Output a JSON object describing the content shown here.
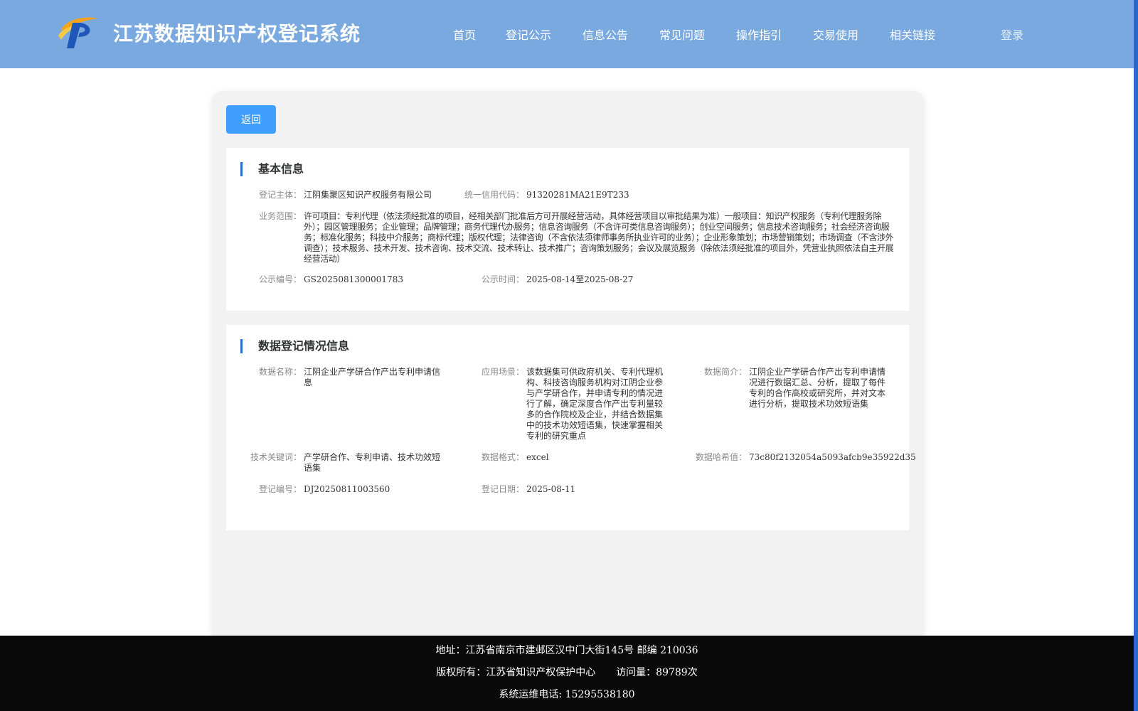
{
  "header": {
    "logo_icon": "ip-logo-icon",
    "title": "江苏数据知识产权登记系统",
    "nav": [
      "首页",
      "登记公示",
      "信息公告",
      "常见问题",
      "操作指引",
      "交易使用",
      "相关链接"
    ],
    "login": "登录"
  },
  "back_button": "返回",
  "basic_info": {
    "title": "基本信息",
    "registrant_label": "登记主体：",
    "registrant": "江阴集聚区知识产权服务有限公司",
    "credit_code_label": "统一信用代码：",
    "credit_code": "91320281MA21E9T233",
    "scope_label": "业务范围：",
    "scope": "许可项目：专利代理（依法须经批准的项目，经相关部门批准后方可开展经营活动，具体经营项目以审批结果为准）一般项目：知识产权服务（专利代理服务除外）；园区管理服务；企业管理；品牌管理；商务代理代办服务；信息咨询服务（不含许可类信息咨询服务）；创业空间服务；信息技术咨询服务；社会经济咨询服务；标准化服务；科技中介服务；商标代理；版权代理；法律咨询（不含依法须律师事务所执业许可的业务）；企业形象策划；市场营销策划；市场调查（不含涉外调查）；技术服务、技术开发、技术咨询、技术交流、技术转让、技术推广；咨询策划服务；会议及展览服务（除依法须经批准的项目外，凭营业执照依法自主开展经营活动）",
    "pub_no_label": "公示编号：",
    "pub_no": "GS2025081300001783",
    "pub_time_label": "公示时间：",
    "pub_time": "2025-08-14至2025-08-27"
  },
  "data_info": {
    "title": "数据登记情况信息",
    "name_label": "数据名称：",
    "name": "江阴企业产学研合作产出专利申请信息",
    "scenario_label": "应用场景：",
    "scenario": "该数据集可供政府机关、专利代理机构、科技咨询服务机构对江阴企业参与产学研合作，并申请专利的情况进行了解，确定深度合作产出专利量较多的合作院校及企业，并结合数据集中的技术功效短语集，快速掌握相关专利的研究重点",
    "summary_label": "数据简介：",
    "summary": "江阴企业产学研合作产出专利申请情况进行数据汇总、分析，提取了每件专利的合作高校或研究所，并对文本进行分析，提取技术功效短语集",
    "keywords_label": "技术关键词：",
    "keywords": "产学研合作、专利申请、技术功效短语集",
    "format_label": "数据格式：",
    "format": "excel",
    "hash_label": "数据哈希值：",
    "hash": "73c80f2132054a5093afcb9e35922d35",
    "reg_no_label": "登记编号：",
    "reg_no": "DJ20250811003560",
    "reg_date_label": "登记日期：",
    "reg_date": "2025-08-11"
  },
  "footer": {
    "address": "地址：江苏省南京市建邺区汉中门大街145号 邮编 210036",
    "copyright": "版权所有：江苏省知识产权保护中心",
    "visits": "访问量：89789次",
    "phone": "系统运维电话: 15295538180"
  },
  "colors": {
    "header_bg": "#79a9df",
    "button": "#409eff",
    "accent_bar": "#2e6ccc",
    "footer_bg": "#0a0a0a"
  }
}
